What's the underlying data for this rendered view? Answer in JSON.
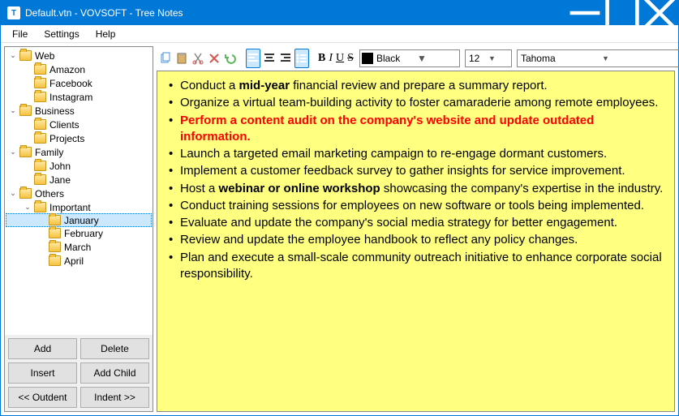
{
  "window": {
    "title": "Default.vtn - VOVSOFT - Tree Notes"
  },
  "menu": [
    "File",
    "Settings",
    "Help"
  ],
  "tree": [
    {
      "label": "Web",
      "depth": 0,
      "expanded": true,
      "children": [
        {
          "label": "Amazon",
          "depth": 1
        },
        {
          "label": "Facebook",
          "depth": 1
        },
        {
          "label": "Instagram",
          "depth": 1
        }
      ]
    },
    {
      "label": "Business",
      "depth": 0,
      "expanded": true,
      "children": [
        {
          "label": "Clients",
          "depth": 1
        },
        {
          "label": "Projects",
          "depth": 1
        }
      ]
    },
    {
      "label": "Family",
      "depth": 0,
      "expanded": true,
      "children": [
        {
          "label": "John",
          "depth": 1
        },
        {
          "label": "Jane",
          "depth": 1
        }
      ]
    },
    {
      "label": "Others",
      "depth": 0,
      "expanded": true,
      "children": [
        {
          "label": "Important",
          "depth": 1,
          "expanded": true,
          "children": [
            {
              "label": "January",
              "depth": 2,
              "selected": true
            },
            {
              "label": "February",
              "depth": 2
            },
            {
              "label": "March",
              "depth": 2
            },
            {
              "label": "April",
              "depth": 2
            }
          ]
        }
      ]
    }
  ],
  "buttons": {
    "add": "Add",
    "delete": "Delete",
    "insert": "Insert",
    "addchild": "Add Child",
    "outdent": "<< Outdent",
    "indent": "Indent >>"
  },
  "toolbar": {
    "color": {
      "label": "Black",
      "value": "#000000"
    },
    "size": "12",
    "font": "Tahoma"
  },
  "notes": [
    {
      "segments": [
        {
          "t": "Conduct a "
        },
        {
          "t": "mid-year",
          "b": true
        },
        {
          "t": " financial review and prepare a summary report."
        }
      ]
    },
    {
      "segments": [
        {
          "t": "Organize a virtual team-building activity to foster camaraderie among remote employees."
        }
      ]
    },
    {
      "segments": [
        {
          "t": "Perform a content audit on the company's website and update outdated information.",
          "red": true
        }
      ]
    },
    {
      "segments": [
        {
          "t": "Launch a targeted email marketing campaign to re-engage dormant customers."
        }
      ]
    },
    {
      "segments": [
        {
          "t": "Implement a customer feedback survey to gather insights for service improvement."
        }
      ]
    },
    {
      "segments": [
        {
          "t": "Host a "
        },
        {
          "t": "webinar or online workshop",
          "b": true
        },
        {
          "t": " showcasing the company's expertise in the industry."
        }
      ]
    },
    {
      "segments": [
        {
          "t": "Conduct training sessions for employees on new software or tools being implemented."
        }
      ]
    },
    {
      "segments": [
        {
          "t": "Evaluate and update the company's social media strategy for better engagement."
        }
      ]
    },
    {
      "segments": [
        {
          "t": "Review and update the employee handbook to reflect any policy changes."
        }
      ]
    },
    {
      "segments": [
        {
          "t": "Plan and execute a small-scale community outreach initiative to enhance corporate social responsibility."
        }
      ]
    }
  ]
}
